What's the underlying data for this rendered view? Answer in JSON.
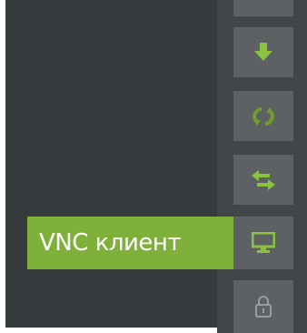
{
  "sidebar": {
    "tooltip_label": "VNC клиент",
    "buttons": [
      {
        "name": "top-partial",
        "icon": "unknown-icon"
      },
      {
        "name": "download",
        "icon": "download-arrow-icon"
      },
      {
        "name": "sync",
        "icon": "refresh-icon"
      },
      {
        "name": "transfer",
        "icon": "swap-arrows-icon"
      },
      {
        "name": "vnc-client",
        "icon": "monitor-icon",
        "active": true
      },
      {
        "name": "lock",
        "icon": "lock-icon"
      }
    ]
  },
  "colors": {
    "panel_dark": "#363a3d",
    "toolbar_bg": "#424648",
    "button_bg": "#5e6163",
    "accent_green": "#7fb13a",
    "icon_green": "#8ac33e",
    "icon_gray": "#9a9d9f"
  }
}
